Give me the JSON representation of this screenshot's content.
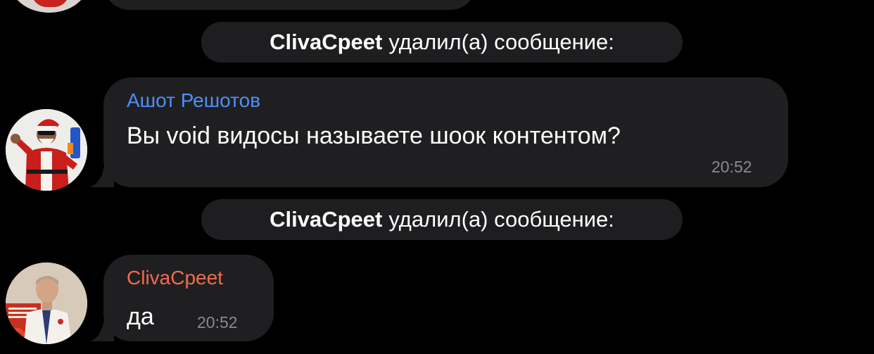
{
  "colors": {
    "background": "#000000",
    "bubble": "#1f1f21",
    "sender_ashot": "#4f8ff7",
    "sender_cliva": "#f26b4d",
    "timestamp": "#8a8a8e"
  },
  "services": [
    {
      "user": "ClivaCpeet",
      "action": "удалил(а) сообщение:"
    },
    {
      "user": "ClivaCpeet",
      "action": "удалил(а) сообщение:"
    }
  ],
  "messages": [
    {
      "sender": "Ашот Решотов",
      "text": "Вы void видосы называете шоок контентом?",
      "time": "20:52",
      "avatar": "santa-avatar"
    },
    {
      "sender": "ClivaCpeet",
      "text": "да",
      "time": "20:52",
      "avatar": "man-avatar"
    }
  ]
}
